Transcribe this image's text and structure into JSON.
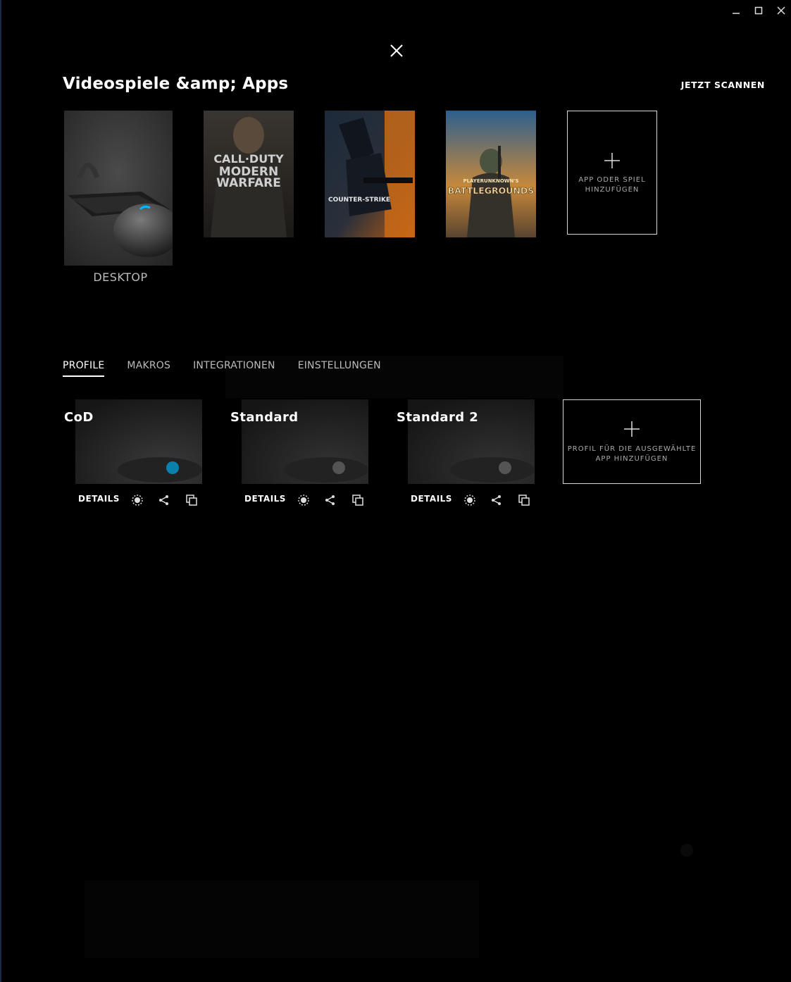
{
  "window": {
    "minimize_icon": "minimize-icon",
    "maximize_icon": "maximize-icon",
    "close_icon": "close-icon"
  },
  "overlay": {
    "close_icon": "close-x-icon",
    "title": "Videospiele &amp; Apps",
    "scan_button": "JETZT SCANNEN"
  },
  "games": {
    "desktop": {
      "label": "DESKTOP"
    },
    "cod": {
      "lines": [
        "CALL·DUTY",
        "MODERN",
        "WARFARE"
      ]
    },
    "csgo": {
      "text": "COUNTER-STRIKE"
    },
    "pubg": {
      "top": "PLAYERUNKNOWN'S",
      "main": "BATTLEGROUNDS"
    },
    "add": {
      "line1": "APP ODER SPIEL",
      "line2": "HINZUFÜGEN"
    }
  },
  "tabs": [
    "PROFILE",
    "MAKROS",
    "INTEGRATIONEN",
    "EINSTELLUNGEN"
  ],
  "profiles": [
    {
      "name": "CoD",
      "details": "DETAILS"
    },
    {
      "name": "Standard",
      "details": "DETAILS"
    },
    {
      "name": "Standard 2",
      "details": "DETAILS"
    }
  ],
  "add_profile": {
    "line1": "PROFIL FÜR DIE AUSGEWÄHLTE",
    "line2": "APP HINZUFÜGEN"
  },
  "colors": {
    "accent": "#00b8ff",
    "background": "#000000",
    "border": "#d8d8d8"
  }
}
